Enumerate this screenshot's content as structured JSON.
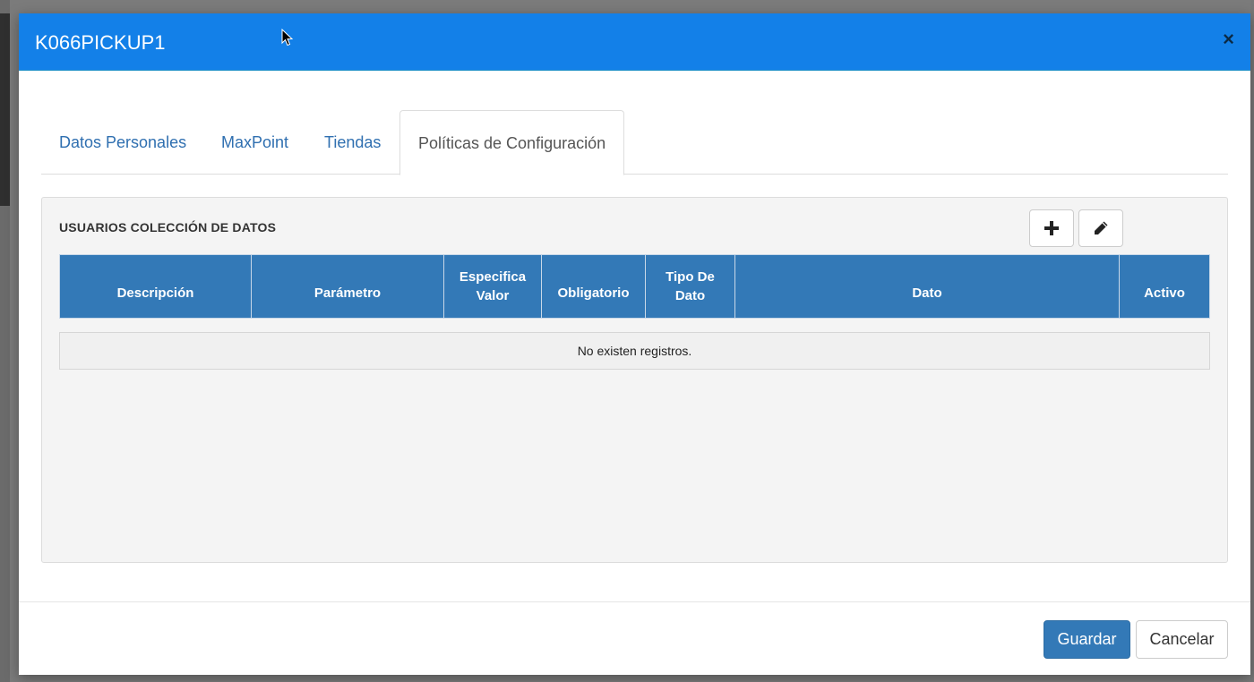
{
  "modal": {
    "title": "K066PICKUP1",
    "close_label": "×"
  },
  "tabs": [
    {
      "label": "Datos Personales",
      "active": false
    },
    {
      "label": "MaxPoint",
      "active": false
    },
    {
      "label": "Tiendas",
      "active": false
    },
    {
      "label": "Políticas de Configuración",
      "active": true
    }
  ],
  "panel": {
    "title": "USUARIOS COLECCIÓN DE DATOS",
    "add_icon": "plus-icon",
    "edit_icon": "pencil-icon"
  },
  "table": {
    "columns": [
      "Descripción",
      "Parámetro",
      "Especifica Valor",
      "Obligatorio",
      "Tipo De Dato",
      "Dato",
      "Activo"
    ],
    "empty_message": "No existen registros."
  },
  "footer": {
    "save_label": "Guardar",
    "cancel_label": "Cancelar"
  },
  "colors": {
    "header": "#1380e8",
    "table_header": "#3379b7",
    "primary_button": "#3379b7"
  }
}
